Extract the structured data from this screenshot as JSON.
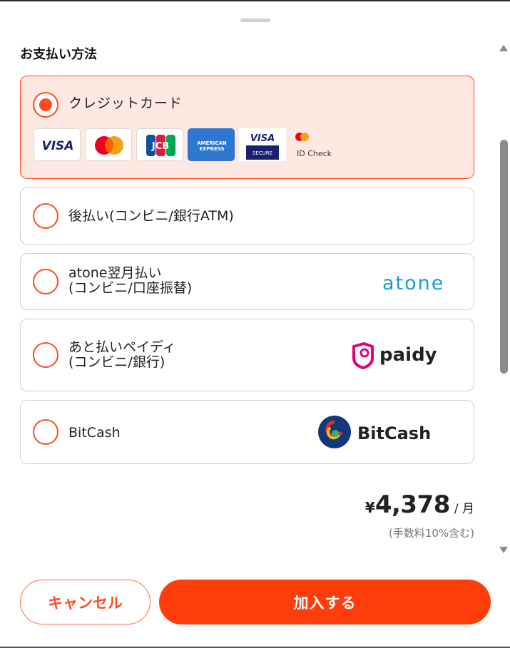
{
  "section_title": "お支払い方法",
  "payment_options": [
    {
      "id": "credit",
      "label": "クレジットカード",
      "selected": true
    },
    {
      "id": "atobarai",
      "label": "後払い(コンビニ/銀行ATM)",
      "selected": false
    },
    {
      "id": "atone",
      "label_line1": "atone翌月払い",
      "label_line2": "(コンビニ/口座振替)",
      "logo_text": "atone",
      "selected": false
    },
    {
      "id": "paidy",
      "label_line1": "あと払いペイディ",
      "label_line2": "(コンビニ/銀行)",
      "logo_text": "paidy",
      "selected": false
    },
    {
      "id": "bitcash",
      "label": "BitCash",
      "logo_text": "BitCash",
      "selected": false
    }
  ],
  "card_logos": {
    "visa": "VISA",
    "jcb": "JCB",
    "amex_line1": "AMERICAN",
    "amex_line2": "EXPRESS",
    "visa_secure_line1": "VISA",
    "visa_secure_line2": "SECURE",
    "id_check": "ID Check"
  },
  "price": {
    "currency": "¥",
    "amount": "4,378",
    "period": "/ 月",
    "note": "(手数料10%含む)"
  },
  "buttons": {
    "cancel": "キャンセル",
    "submit": "加入する"
  },
  "colors": {
    "accent": "#ff4b1e",
    "selected_bg": "#fde8e2",
    "atone": "#1a9bd7",
    "paidy": "#e5007e",
    "bitcash_blue": "#14397a"
  }
}
